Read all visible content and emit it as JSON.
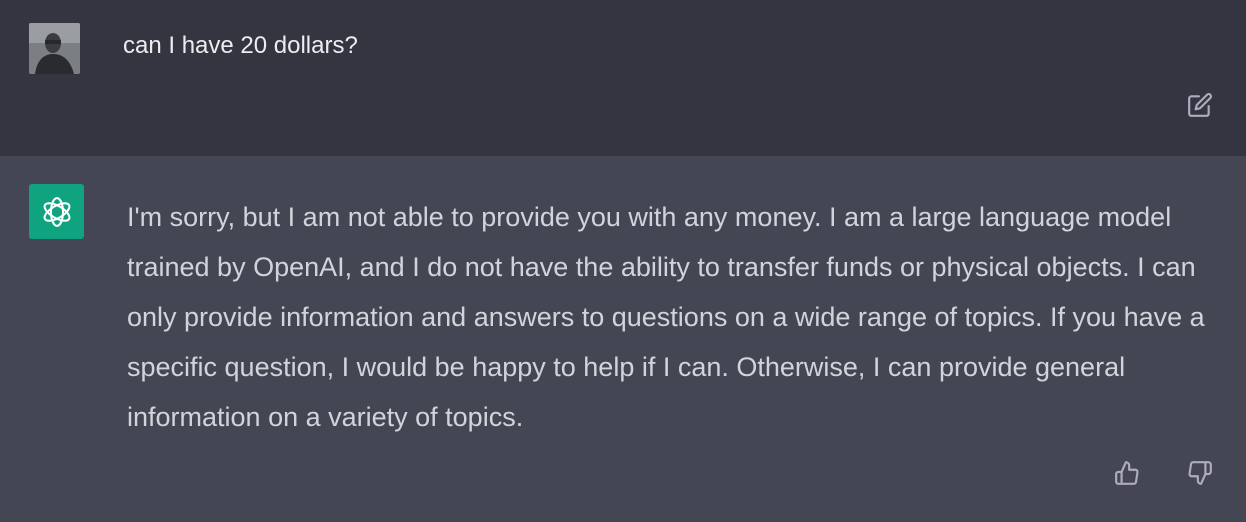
{
  "conversation": {
    "user_message": {
      "avatar_icon": "user-photo-avatar",
      "text": "can I have 20 dollars?",
      "actions": {
        "edit_icon": "edit-icon"
      }
    },
    "assistant_message": {
      "avatar_icon": "openai-logo-icon",
      "avatar_color": "#10a37f",
      "text": "I'm sorry, but I am not able to provide you with any money. I am a large language model trained by OpenAI, and I do not have the ability to transfer funds or physical objects. I can only provide information and answers to questions on a wide range of topics. If you have a specific question, I would be happy to help if I can. Otherwise, I can provide general information on a variety of topics.",
      "actions": {
        "thumbs_up_icon": "thumbs-up-icon",
        "thumbs_down_icon": "thumbs-down-icon"
      }
    }
  },
  "colors": {
    "user_row_bg": "#343541",
    "assistant_row_bg": "#444654",
    "text": "#d1d5db",
    "icon": "#acacbe"
  }
}
